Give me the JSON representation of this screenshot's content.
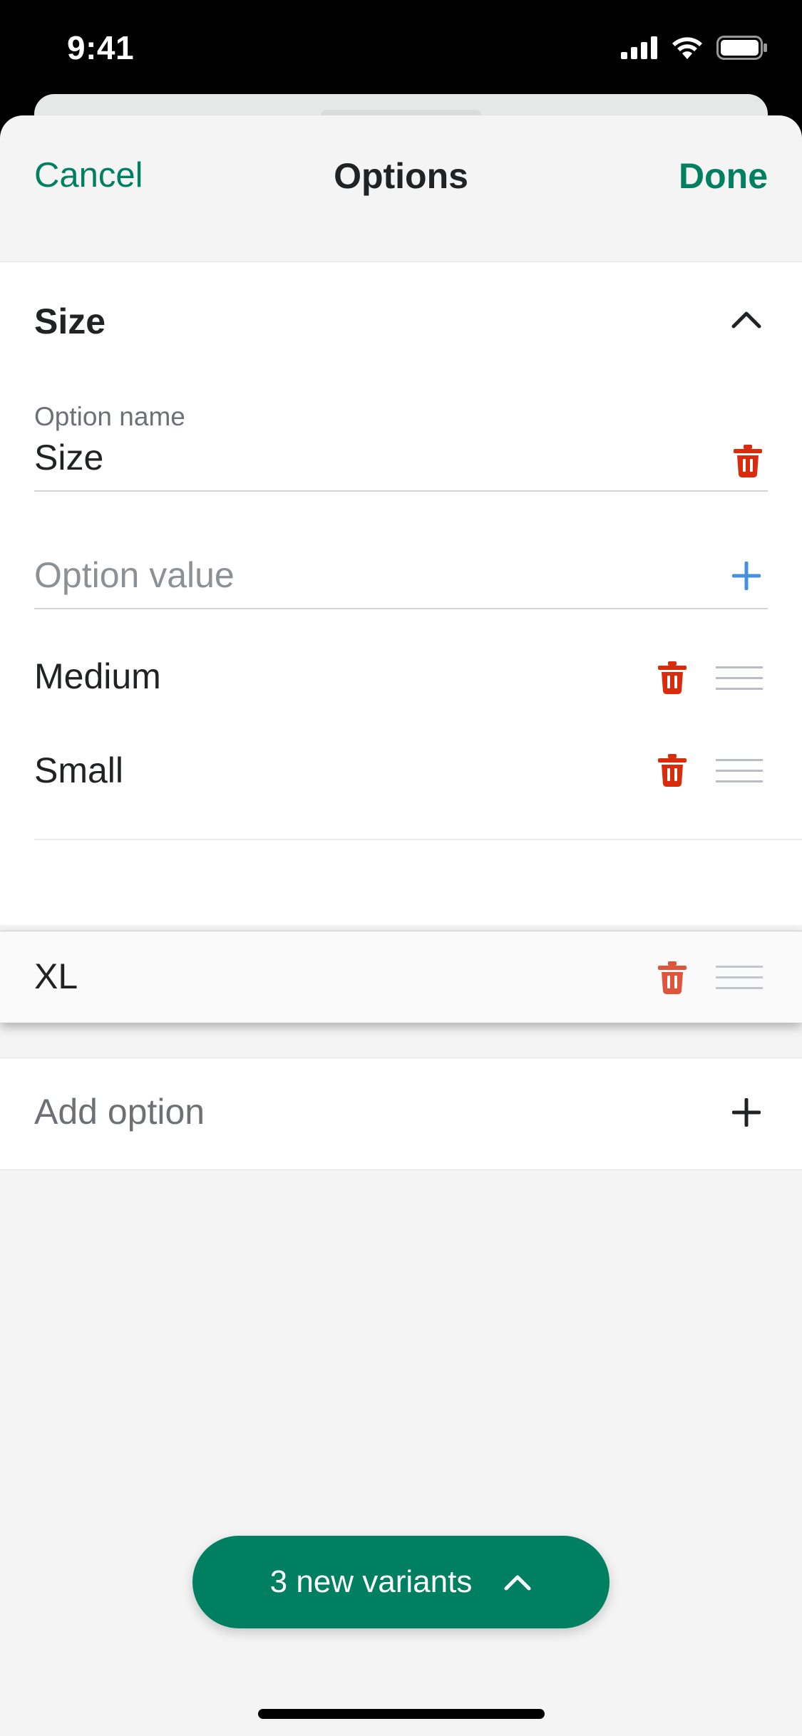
{
  "status_bar": {
    "time": "9:41"
  },
  "nav": {
    "cancel": "Cancel",
    "title": "Options",
    "done": "Done"
  },
  "option_card": {
    "header": "Size",
    "option_name_label": "Option name",
    "option_name_value": "Size",
    "option_value_placeholder": "Option value",
    "values": [
      {
        "label": "Medium"
      },
      {
        "label": "Small"
      },
      {
        "label": "XL"
      }
    ]
  },
  "add_option": {
    "label": "Add option"
  },
  "variants_button": {
    "label": "3 new variants"
  },
  "colors": {
    "accent": "#008060",
    "destructive": "#D82C0D",
    "link_blue": "#458FDB"
  },
  "icons": [
    "signal-icon",
    "wifi-icon",
    "battery-icon",
    "chevron-up-icon",
    "trash-icon",
    "plus-icon",
    "drag-handle-icon"
  ]
}
